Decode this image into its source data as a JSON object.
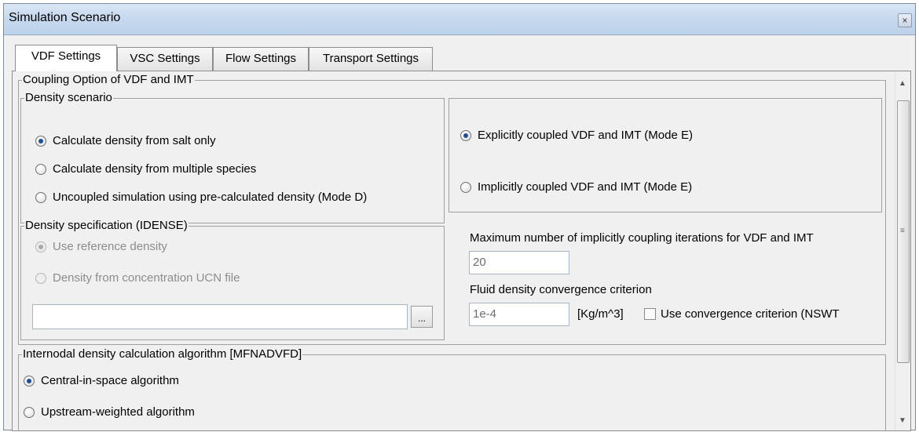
{
  "window": {
    "title": "Simulation Scenario",
    "close_glyph": "×"
  },
  "tabs": [
    {
      "label": "VDF Settings",
      "active": true
    },
    {
      "label": "VSC Settings",
      "active": false
    },
    {
      "label": "Flow Settings",
      "active": false
    },
    {
      "label": "Transport Settings",
      "active": false
    }
  ],
  "coupling": {
    "legend": "Coupling Option of VDF and IMT",
    "density_scenario": {
      "legend": "Density scenario",
      "options": [
        {
          "label": "Calculate density from salt only",
          "selected": true
        },
        {
          "label": "Calculate density from multiple species",
          "selected": false
        },
        {
          "label": "Uncoupled simulation using pre-calculated density (Mode D)",
          "selected": false
        }
      ]
    },
    "mode": {
      "options": [
        {
          "label": "Explicitly coupled VDF and IMT (Mode E)",
          "selected": true
        },
        {
          "label": "Implicitly coupled VDF and IMT (Mode E)",
          "selected": false
        }
      ]
    },
    "density_spec": {
      "legend": "Density specification (IDENSE)",
      "options": [
        {
          "label": "Use reference density",
          "selected": true
        },
        {
          "label": "Density from concentration UCN file",
          "selected": false
        }
      ],
      "file_path": "",
      "browse_label": "..."
    },
    "max_iterations": {
      "label": "Maximum number of implicitly coupling iterations for VDF and IMT",
      "value": "20"
    },
    "convergence": {
      "label": "Fluid density convergence criterion",
      "value": "1e-4",
      "unit": "[Kg/m^3]",
      "checkbox_label": "Use convergence criterion (NSWT",
      "checked": false
    }
  },
  "internodal": {
    "legend": "Internodal density calculation algorithm [MFNADVFD]",
    "options": [
      {
        "label": "Central-in-space algorithm",
        "selected": true
      },
      {
        "label": "Upstream-weighted algorithm",
        "selected": false
      }
    ]
  },
  "scrollbar": {
    "up": "▲",
    "down": "▼",
    "grip": "≡"
  }
}
